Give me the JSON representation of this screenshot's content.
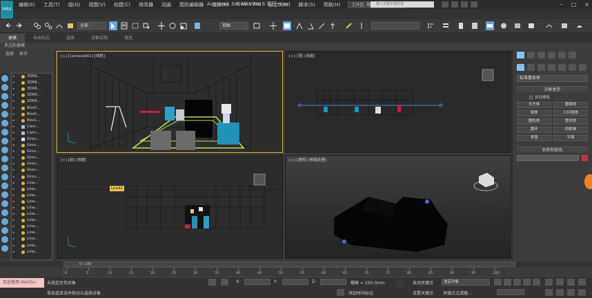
{
  "titlebar": {
    "logo_text": "MAX",
    "menus": [
      "编辑(E)",
      "工具(T)",
      "组(G)",
      "视图(V)",
      "创建(C)",
      "修改器",
      "动画",
      "图形编辑器",
      "渲染(R)",
      "Civil View",
      "自定义(U)",
      "脚本(S)",
      "帮助(H)"
    ],
    "workspace_label": "工作区: 默认",
    "app_title": "Autodesk 3ds Max 2016    客厅.max",
    "search_placeholder": "键入关键字或短语",
    "win_controls": [
      "–",
      "□",
      "×"
    ]
  },
  "toolbar": {
    "selection_filter": "全部",
    "reference_coord": "视图",
    "named_selection": ""
  },
  "ribbon": {
    "tabs": [
      "建模",
      "自由形式",
      "选择",
      "对象绘制",
      "填充"
    ],
    "active_tab": 0,
    "sub_label": "多边形建模"
  },
  "explorer": {
    "header": [
      "选择",
      "显示"
    ],
    "items": [
      {
        "name": "3D66...",
        "type": "light"
      },
      {
        "name": "3D66...",
        "type": "light"
      },
      {
        "name": "3D66...",
        "type": "light"
      },
      {
        "name": "3D66...",
        "type": "light"
      },
      {
        "name": "3D66...",
        "type": "light"
      },
      {
        "name": "Box0...",
        "type": "light"
      },
      {
        "name": "Box0...",
        "type": "light"
      },
      {
        "name": "Box1...",
        "type": "light"
      },
      {
        "name": "Cam...",
        "type": "camera"
      },
      {
        "name": "Cam...",
        "type": "camera"
      },
      {
        "name": "Grou...",
        "type": "group"
      },
      {
        "name": "Grou...",
        "type": "light"
      },
      {
        "name": "Grou...",
        "type": "light"
      },
      {
        "name": "Grou...",
        "type": "light"
      },
      {
        "name": "Grou...",
        "type": "light"
      },
      {
        "name": "Grou...",
        "type": "light"
      },
      {
        "name": "Grou...",
        "type": "light"
      },
      {
        "name": "Line...",
        "type": "light"
      },
      {
        "name": "Line...",
        "type": "light"
      },
      {
        "name": "Line...",
        "type": "light"
      },
      {
        "name": "Line...",
        "type": "light"
      },
      {
        "name": "Line...",
        "type": "light"
      },
      {
        "name": "Line...",
        "type": "light"
      },
      {
        "name": "Line...",
        "type": "light"
      },
      {
        "name": "Line...",
        "type": "light"
      },
      {
        "name": "Line...",
        "type": "light"
      },
      {
        "name": "Line...",
        "type": "light"
      },
      {
        "name": "Line...",
        "type": "light"
      },
      {
        "name": "Line...",
        "type": "light"
      }
    ]
  },
  "viewports": {
    "camera": "[+] [Camera001] [线框]",
    "top": "[+] [顶] [线框]",
    "front": "[+] [前] [线框]",
    "perspective": "[+] [透视] [明暗处理]",
    "front_tag": "Line42"
  },
  "cmdpanel": {
    "category": "标准基本体",
    "object_type_title": "对象类型",
    "autogrid_label": "自动栅格",
    "objects": [
      "长方体",
      "圆锥体",
      "球体",
      "几何球体",
      "圆柱体",
      "管状体",
      "圆环",
      "四棱锥",
      "茶壶",
      "平面"
    ],
    "name_color_title": "名称和颜色",
    "swatch_color": "#c4304a"
  },
  "timeline": {
    "frame": "0 / 100",
    "ticks": [
      "0",
      "5",
      "10",
      "15",
      "20",
      "25",
      "30",
      "35",
      "40",
      "45",
      "50",
      "55",
      "60",
      "65",
      "70",
      "75",
      "80",
      "85",
      "90",
      "95",
      "100"
    ]
  },
  "status": {
    "welcome": "欢迎使用 MAXScr",
    "line1": "未选定任何对象",
    "line2": "单击或单击并拖动以选择对象",
    "x_label": "X:",
    "y_label": "Y:",
    "z_label": "Z:",
    "grid": "栅格 = 100.0mm",
    "add_time_tag": "添加时间标记",
    "auto_key": "自动关键点",
    "set_key": "设置关键点",
    "selected_dd": "选定对象",
    "key_filters": "关键点过滤器..."
  }
}
